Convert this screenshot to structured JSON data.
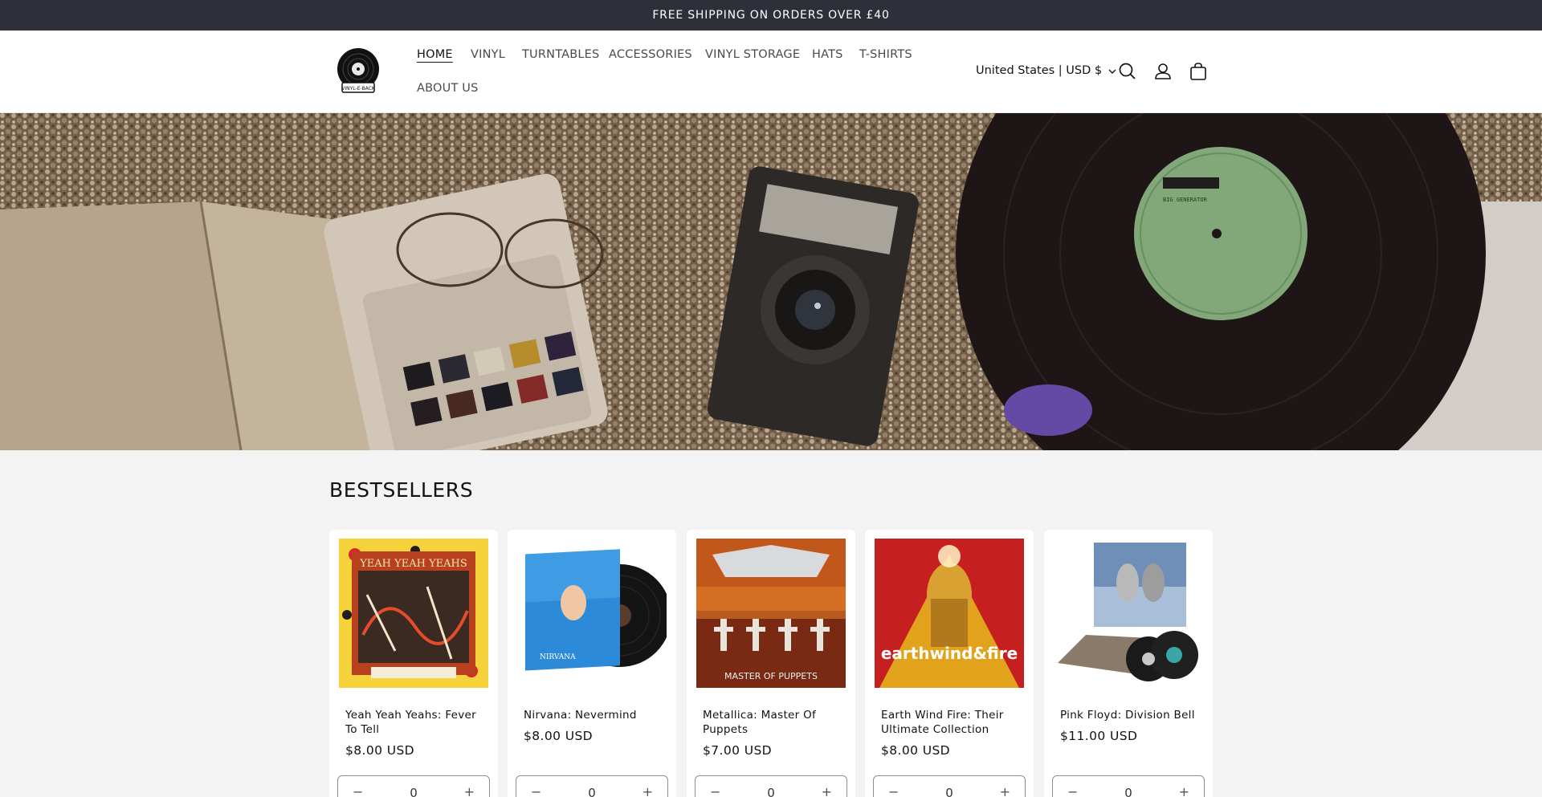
{
  "announcement": "FREE SHIPPING ON ORDERS OVER £40",
  "logo": {
    "text": "VINYL-E-BACK"
  },
  "nav": {
    "items": [
      {
        "label": "HOME",
        "active": true
      },
      {
        "label": "VINYL"
      },
      {
        "label": "TURNTABLES"
      },
      {
        "label": "ACCESSORIES"
      },
      {
        "label": "VINYL STORAGE"
      },
      {
        "label": "HATS"
      },
      {
        "label": "T-SHIRTS"
      },
      {
        "label": "ABOUT US"
      }
    ]
  },
  "country_selector": {
    "label": "United States | USD $",
    "icon": "chevron-down-icon"
  },
  "header_icons": [
    "search-icon",
    "account-icon",
    "cart-icon"
  ],
  "hero": {
    "record_label_text": "BIG GENERATOR"
  },
  "bestsellers": {
    "title": "BESTSELLERS",
    "products": [
      {
        "title": "Yeah Yeah Yeahs: Fever To Tell",
        "price": "$8.00 USD",
        "quantity": "0",
        "cover_text": "YEAH YEAH YEAHS"
      },
      {
        "title": "Nirvana: Nevermind",
        "price": "$8.00 USD",
        "quantity": "0",
        "cover_text": "NIRVANA"
      },
      {
        "title": "Metallica: Master Of Puppets",
        "price": "$7.00 USD",
        "quantity": "0",
        "cover_text": "MASTER OF PUPPETS"
      },
      {
        "title": "Earth Wind Fire: Their Ultimate Collection",
        "price": "$8.00 USD",
        "quantity": "0",
        "cover_text": "earthwind&fire"
      },
      {
        "title": "Pink Floyd: Division Bell",
        "price": "$11.00 USD",
        "quantity": "0",
        "cover_text": ""
      }
    ]
  },
  "colors": {
    "announcement_bg": "#2d3038",
    "page_bg": "#f3f3f3",
    "card_bg": "#ffffff",
    "text": "#121212"
  }
}
